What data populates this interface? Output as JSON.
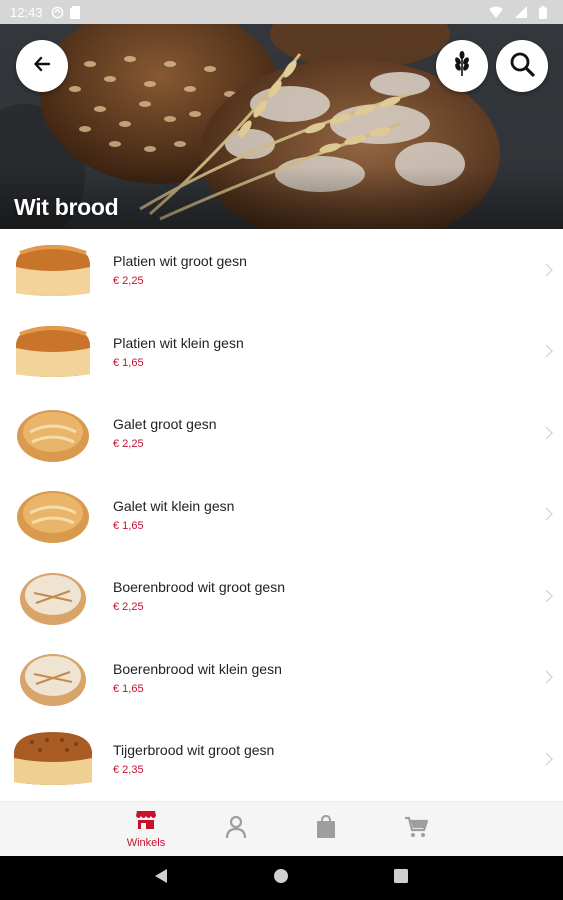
{
  "status_bar": {
    "time": "12:43"
  },
  "header": {
    "title": "Wit brood"
  },
  "products": [
    {
      "name": "Platien wit groot gesn",
      "price": "€ 2,25"
    },
    {
      "name": "Platien wit klein gesn",
      "price": "€ 1,65"
    },
    {
      "name": "Galet groot gesn",
      "price": "€ 2,25"
    },
    {
      "name": "Galet wit klein gesn",
      "price": "€ 1,65"
    },
    {
      "name": "Boerenbrood wit groot gesn",
      "price": "€ 2,25"
    },
    {
      "name": "Boerenbrood wit klein gesn",
      "price": "€ 1,65"
    },
    {
      "name": "Tijgerbrood wit groot gesn",
      "price": "€ 2,35"
    }
  ],
  "bottom_nav": {
    "active_label": "Winkels"
  },
  "colors": {
    "accent": "#c8102e",
    "price": "#c8102e",
    "nav_inactive": "#9e9e9e",
    "nav_background": "#f5f5f5"
  },
  "icons": [
    "back-arrow-icon",
    "wheat-icon",
    "search-icon",
    "store-icon",
    "person-icon",
    "bag-icon",
    "cart-icon",
    "chevron-right-icon"
  ]
}
